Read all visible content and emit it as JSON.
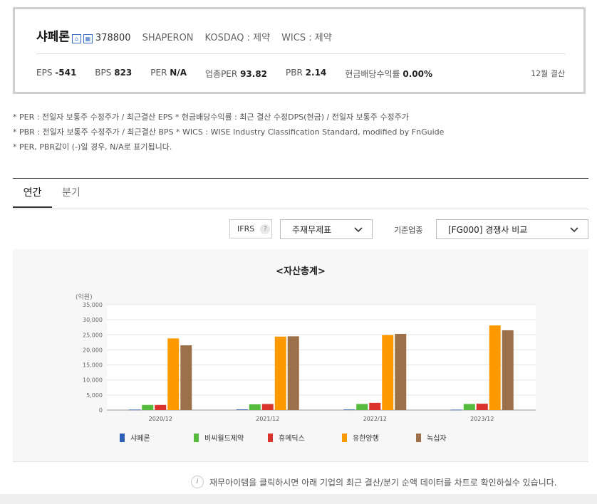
{
  "company": {
    "name": "샤페론",
    "code": "378800",
    "english_name": "SHAPERON",
    "market": "KOSDAQ : 제약",
    "wics": "WICS : 제약",
    "settlement": "12월 결산"
  },
  "stats": [
    {
      "label": "EPS",
      "value": "-541"
    },
    {
      "label": "BPS",
      "value": "823"
    },
    {
      "label": "PER",
      "value": "N/A"
    },
    {
      "label": "업종PER",
      "value": "93.82"
    },
    {
      "label": "PBR",
      "value": "2.14"
    },
    {
      "label": "현금배당수익률",
      "value": "0.00%"
    }
  ],
  "notes": [
    "* PER : 전일자 보통주 수정주가 / 최근결산 EPS * 현금배당수익률 : 최근 결산 수정DPS(현금) / 전일자 보통주 수정주가",
    "* PBR : 전일자 보통주 수정주가 / 최근결산 BPS * WICS : WISE Industry Classification Standard, modified by FnGuide",
    "* PER, PBR값이 (-)일 경우, N/A로 표기됩니다."
  ],
  "tabs": {
    "annual": "연간",
    "quarter": "분기"
  },
  "controls": {
    "ifrs": "IFRS",
    "help": "?",
    "statement": "주재무제표",
    "basis_label": "기준업종",
    "basis_value": "[FG000] 경쟁사 비교"
  },
  "footnote": "재무아이템을 클릭하시면 아래 기업의 최근 결산/분기 순액 데이터를 차트로 확인하실수 있습니다.",
  "chart_data": {
    "type": "bar",
    "title": "<자산총계>",
    "unit": "(억원)",
    "categories": [
      "2020/12",
      "2021/12",
      "2022/12",
      "2023/12"
    ],
    "ylim": [
      0,
      35000
    ],
    "yticks": [
      "0",
      "5,000",
      "10,000",
      "15,000",
      "20,000",
      "25,000",
      "30,000",
      "35,000"
    ],
    "grid": true,
    "legend_position": "bottom",
    "series": [
      {
        "name": "샤페론",
        "color": "#2f5fb3",
        "values": [
          150,
          200,
          180,
          130
        ]
      },
      {
        "name": "비씨월드제약",
        "color": "#55bb3c",
        "values": [
          1700,
          1900,
          2000,
          2000
        ]
      },
      {
        "name": "휴메딕스",
        "color": "#d9332c",
        "values": [
          1700,
          2000,
          2400,
          2100
        ]
      },
      {
        "name": "유한양행",
        "color": "#ff9900",
        "values": [
          23800,
          24400,
          24900,
          28100
        ]
      },
      {
        "name": "녹십자",
        "color": "#9c7048",
        "values": [
          21500,
          24500,
          25300,
          26500
        ]
      }
    ]
  }
}
